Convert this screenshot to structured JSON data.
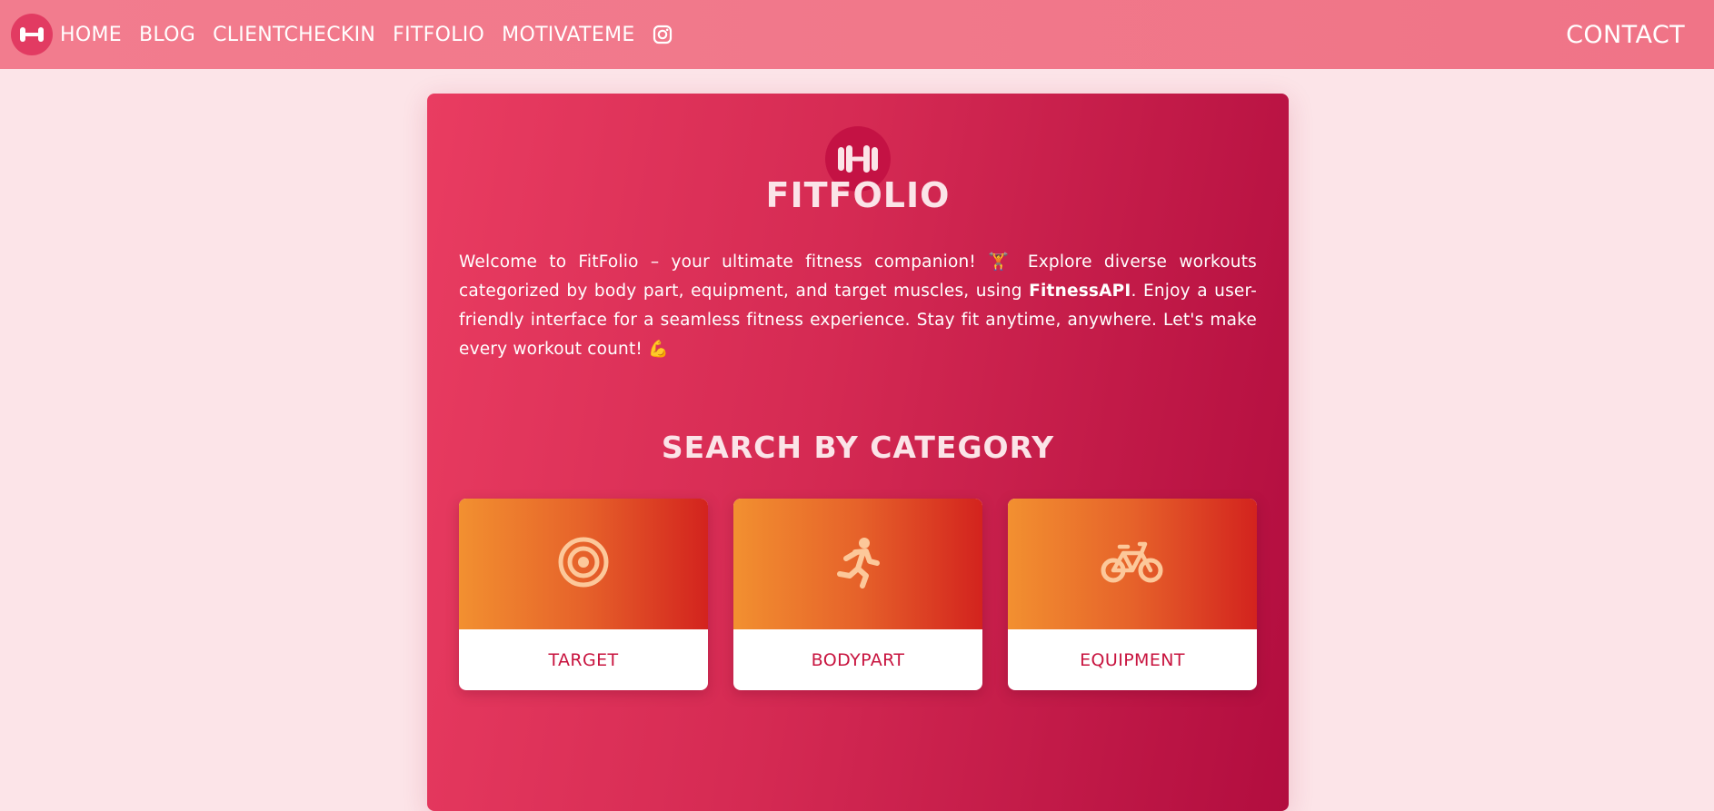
{
  "nav": {
    "links": [
      "HOME",
      "BLOG",
      "CLIENTCHECKIN",
      "FITFOLIO",
      "MOTIVATEME"
    ],
    "contact": "CONTACT",
    "icons": {
      "logo": "dumbbell-icon",
      "social": "instagram-icon"
    }
  },
  "hero": {
    "title": "FITFOLIO",
    "intro_part1": "Welcome to FitFolio – your ultimate fitness companion! 🏋  Explore diverse workouts categorized by body part, equipment, and target muscles, using ",
    "intro_brand": "FitnessAPI",
    "intro_part2": ". Enjoy a user-friendly interface for a seamless fitness experience. Stay fit anytime, anywhere. Let's make every workout count! ",
    "intro_emoji": "💪",
    "section_title": "SEARCH BY CATEGORY"
  },
  "categories": [
    {
      "label": "TARGET",
      "icon": "target-icon"
    },
    {
      "label": "BODYPART",
      "icon": "running-person-icon"
    },
    {
      "label": "EQUIPMENT",
      "icon": "bicycle-icon"
    }
  ],
  "colors": {
    "page_bg": "#fce4e8",
    "navbar": "#f27c8e",
    "hero_start": "#e93c61",
    "hero_end": "#b20d3f",
    "card_gradient_start": "#f29030",
    "card_gradient_end": "#d3231e",
    "card_icon": "#fcc89a",
    "card_label": "#c8143f"
  }
}
